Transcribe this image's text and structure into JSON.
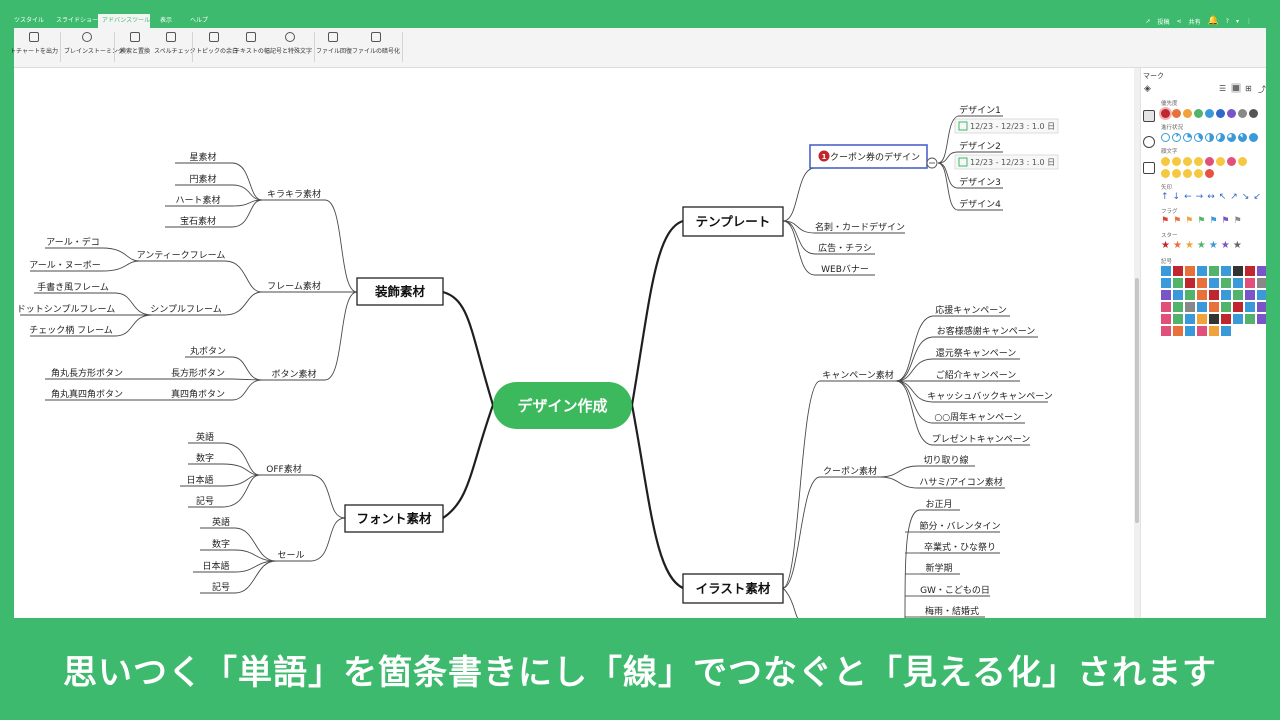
{
  "menu": {
    "tabs": [
      "ツスタイル",
      "スライドショー",
      "アドバンスツール",
      "表示",
      "ヘルプ"
    ],
    "active_tab": "アドバンスツール",
    "right": {
      "post": "投稿",
      "share": "共有",
      "help": "?"
    }
  },
  "ribbon": {
    "items": [
      "トチャートを出力",
      "ブレインストーミング",
      "検索と置換",
      "スペルチェック",
      "トピックの余白",
      "テキストの幅",
      "記号と特殊文字",
      "ファイル回復",
      "ファイルの暗号化"
    ]
  },
  "mindmap": {
    "central": "デザイン作成",
    "main_topics": {
      "decoration": "装飾素材",
      "font": "フォント素材",
      "template": "テンプレート",
      "illustration": "イラスト素材"
    },
    "decoration": {
      "sparkle": "キラキラ素材",
      "sparkle_items": [
        "星素材",
        "円素材",
        "ハート素材",
        "宝石素材"
      ],
      "frame": "フレーム素材",
      "antique": "アンティークフレーム",
      "antique_items": [
        "アール・デコ",
        "アール・ヌーボー"
      ],
      "simple": "シンプルフレーム",
      "simple_items": [
        "手書き風フレーム",
        "ドットシンプルフレーム",
        "チェック柄 フレーム"
      ],
      "button": "ボタン素材",
      "maru": "丸ボタン",
      "rect": "長方形ボタン",
      "rect_sub": "角丸長方形ボタン",
      "square": "真四角ボタン",
      "square_sub": "角丸真四角ボタン"
    },
    "font": {
      "off": "OFF素材",
      "off_items": [
        "英語",
        "数字",
        "日本語",
        "記号"
      ],
      "sale": "セール",
      "sale_items": [
        "英語",
        "数字",
        "日本語",
        "記号"
      ]
    },
    "template": {
      "coupon": "クーポン券のデザイン",
      "coupon_badge": "1",
      "designs": [
        "デザイン1",
        "デザイン2",
        "デザイン3",
        "デザイン4"
      ],
      "task_dates": "12/23 - 12/23 : 1.0 日",
      "others": [
        "名刺・カードデザイン",
        "広告・チラシ",
        "WEBバナー"
      ]
    },
    "illustration": {
      "campaign": "キャンペーン素材",
      "campaign_items": [
        "応援キャンペーン",
        "お客様感謝キャンペーン",
        "還元祭キャンペーン",
        "ご紹介キャンペーン",
        "キャッシュバックキャンペーン",
        "○○周年キャンペーン",
        "プレゼントキャンペーン"
      ],
      "coupon": "クーポン素材",
      "coupon_items": [
        "切り取り線",
        "ハサミ/アイコン素材"
      ],
      "seasons": [
        "お正月",
        "節分・バレンタイン",
        "卒業式・ひな祭り",
        "新学期",
        "GW・こどもの日",
        "梅雨・結婚式"
      ]
    }
  },
  "panel": {
    "title": "マーク",
    "sections": [
      "優先度",
      "進行状況",
      "顔文字",
      "矢印",
      "フラグ",
      "スター",
      "記号"
    ],
    "priority_numbers": [
      "1",
      "2",
      "3",
      "4",
      "5",
      "6",
      "7",
      "8",
      "9"
    ]
  },
  "caption": "思いつく「単語」を箇条書きにし「線」でつなぐと「見える化」されます",
  "colors": {
    "brand_green": "#3dba6e",
    "central_green": "#3cb95c",
    "selected_blue": "#4a64c8",
    "badge_red": "#c0262d"
  }
}
